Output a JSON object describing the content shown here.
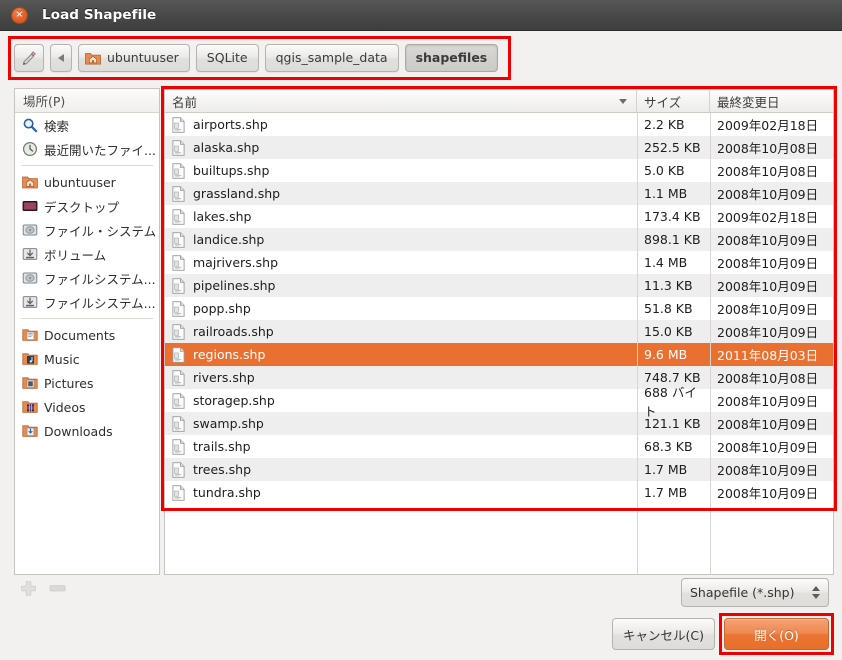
{
  "window": {
    "title": "Load Shapefile",
    "close_label": "×"
  },
  "toolbar": {
    "edit_path_icon": "pencil-icon",
    "back_icon": "left-arrow-icon",
    "crumbs": [
      {
        "label": "ubuntuuser",
        "icon": "home-folder-icon",
        "active": false
      },
      {
        "label": "SQLite",
        "icon": "",
        "active": false
      },
      {
        "label": "qgis_sample_data",
        "icon": "",
        "active": false
      },
      {
        "label": "shapefiles",
        "icon": "",
        "active": true
      }
    ]
  },
  "places": {
    "header": "場所(P)",
    "groups": [
      [
        {
          "label": "検索",
          "icon": "search-icon"
        },
        {
          "label": "最近開いたファイ...",
          "icon": "recent-icon"
        }
      ],
      [
        {
          "label": "ubuntuuser",
          "icon": "home-folder-icon"
        },
        {
          "label": "デスクトップ",
          "icon": "desktop-icon"
        },
        {
          "label": "ファイル・システム",
          "icon": "harddisk-icon"
        },
        {
          "label": "ボリューム",
          "icon": "volume-icon"
        },
        {
          "label": "ファイルシステム...",
          "icon": "harddisk-icon"
        },
        {
          "label": "ファイルシステム...",
          "icon": "volume-icon"
        }
      ],
      [
        {
          "label": "Documents",
          "icon": "documents-folder-icon"
        },
        {
          "label": "Music",
          "icon": "music-folder-icon"
        },
        {
          "label": "Pictures",
          "icon": "pictures-folder-icon"
        },
        {
          "label": "Videos",
          "icon": "videos-folder-icon"
        },
        {
          "label": "Downloads",
          "icon": "downloads-folder-icon"
        }
      ]
    ],
    "add_icon": "plus-icon",
    "remove_icon": "minus-icon"
  },
  "filelist": {
    "columns": [
      {
        "key": "name",
        "label": "名前",
        "sorted": true,
        "sort_icon": "sort-desc-icon"
      },
      {
        "key": "size",
        "label": "サイズ",
        "sorted": false
      },
      {
        "key": "date",
        "label": "最終変更日",
        "sorted": false
      }
    ],
    "rows": [
      {
        "name": "airports.shp",
        "size": "2.2 KB",
        "date": "2009年02月18日",
        "selected": false
      },
      {
        "name": "alaska.shp",
        "size": "252.5 KB",
        "date": "2008年10月08日",
        "selected": false
      },
      {
        "name": "builtups.shp",
        "size": "5.0 KB",
        "date": "2008年10月08日",
        "selected": false
      },
      {
        "name": "grassland.shp",
        "size": "1.1 MB",
        "date": "2008年10月09日",
        "selected": false
      },
      {
        "name": "lakes.shp",
        "size": "173.4 KB",
        "date": "2009年02月18日",
        "selected": false
      },
      {
        "name": "landice.shp",
        "size": "898.1 KB",
        "date": "2008年10月09日",
        "selected": false
      },
      {
        "name": "majrivers.shp",
        "size": "1.4 MB",
        "date": "2008年10月09日",
        "selected": false
      },
      {
        "name": "pipelines.shp",
        "size": "11.3 KB",
        "date": "2008年10月09日",
        "selected": false
      },
      {
        "name": "popp.shp",
        "size": "51.8 KB",
        "date": "2008年10月09日",
        "selected": false
      },
      {
        "name": "railroads.shp",
        "size": "15.0 KB",
        "date": "2008年10月09日",
        "selected": false
      },
      {
        "name": "regions.shp",
        "size": "9.6 MB",
        "date": "2011年08月03日",
        "selected": true
      },
      {
        "name": "rivers.shp",
        "size": "748.7 KB",
        "date": "2008年10月08日",
        "selected": false
      },
      {
        "name": "storagep.shp",
        "size": "688 バイト",
        "date": "2008年10月09日",
        "selected": false
      },
      {
        "name": "swamp.shp",
        "size": "121.1 KB",
        "date": "2008年10月09日",
        "selected": false
      },
      {
        "name": "trails.shp",
        "size": "68.3 KB",
        "date": "2008年10月09日",
        "selected": false
      },
      {
        "name": "trees.shp",
        "size": "1.7 MB",
        "date": "2008年10月09日",
        "selected": false
      },
      {
        "name": "tundra.shp",
        "size": "1.7 MB",
        "date": "2008年10月09日",
        "selected": false
      }
    ]
  },
  "footer": {
    "filter_value": "Shapefile (*.shp)",
    "cancel_label": "キャンセル(C)",
    "open_label": "開く(O)"
  },
  "colors": {
    "selection": "#ea7032",
    "accent_button": "#e8702c",
    "annotation": "#ee0000",
    "titlebar": "#4b4a4a"
  }
}
